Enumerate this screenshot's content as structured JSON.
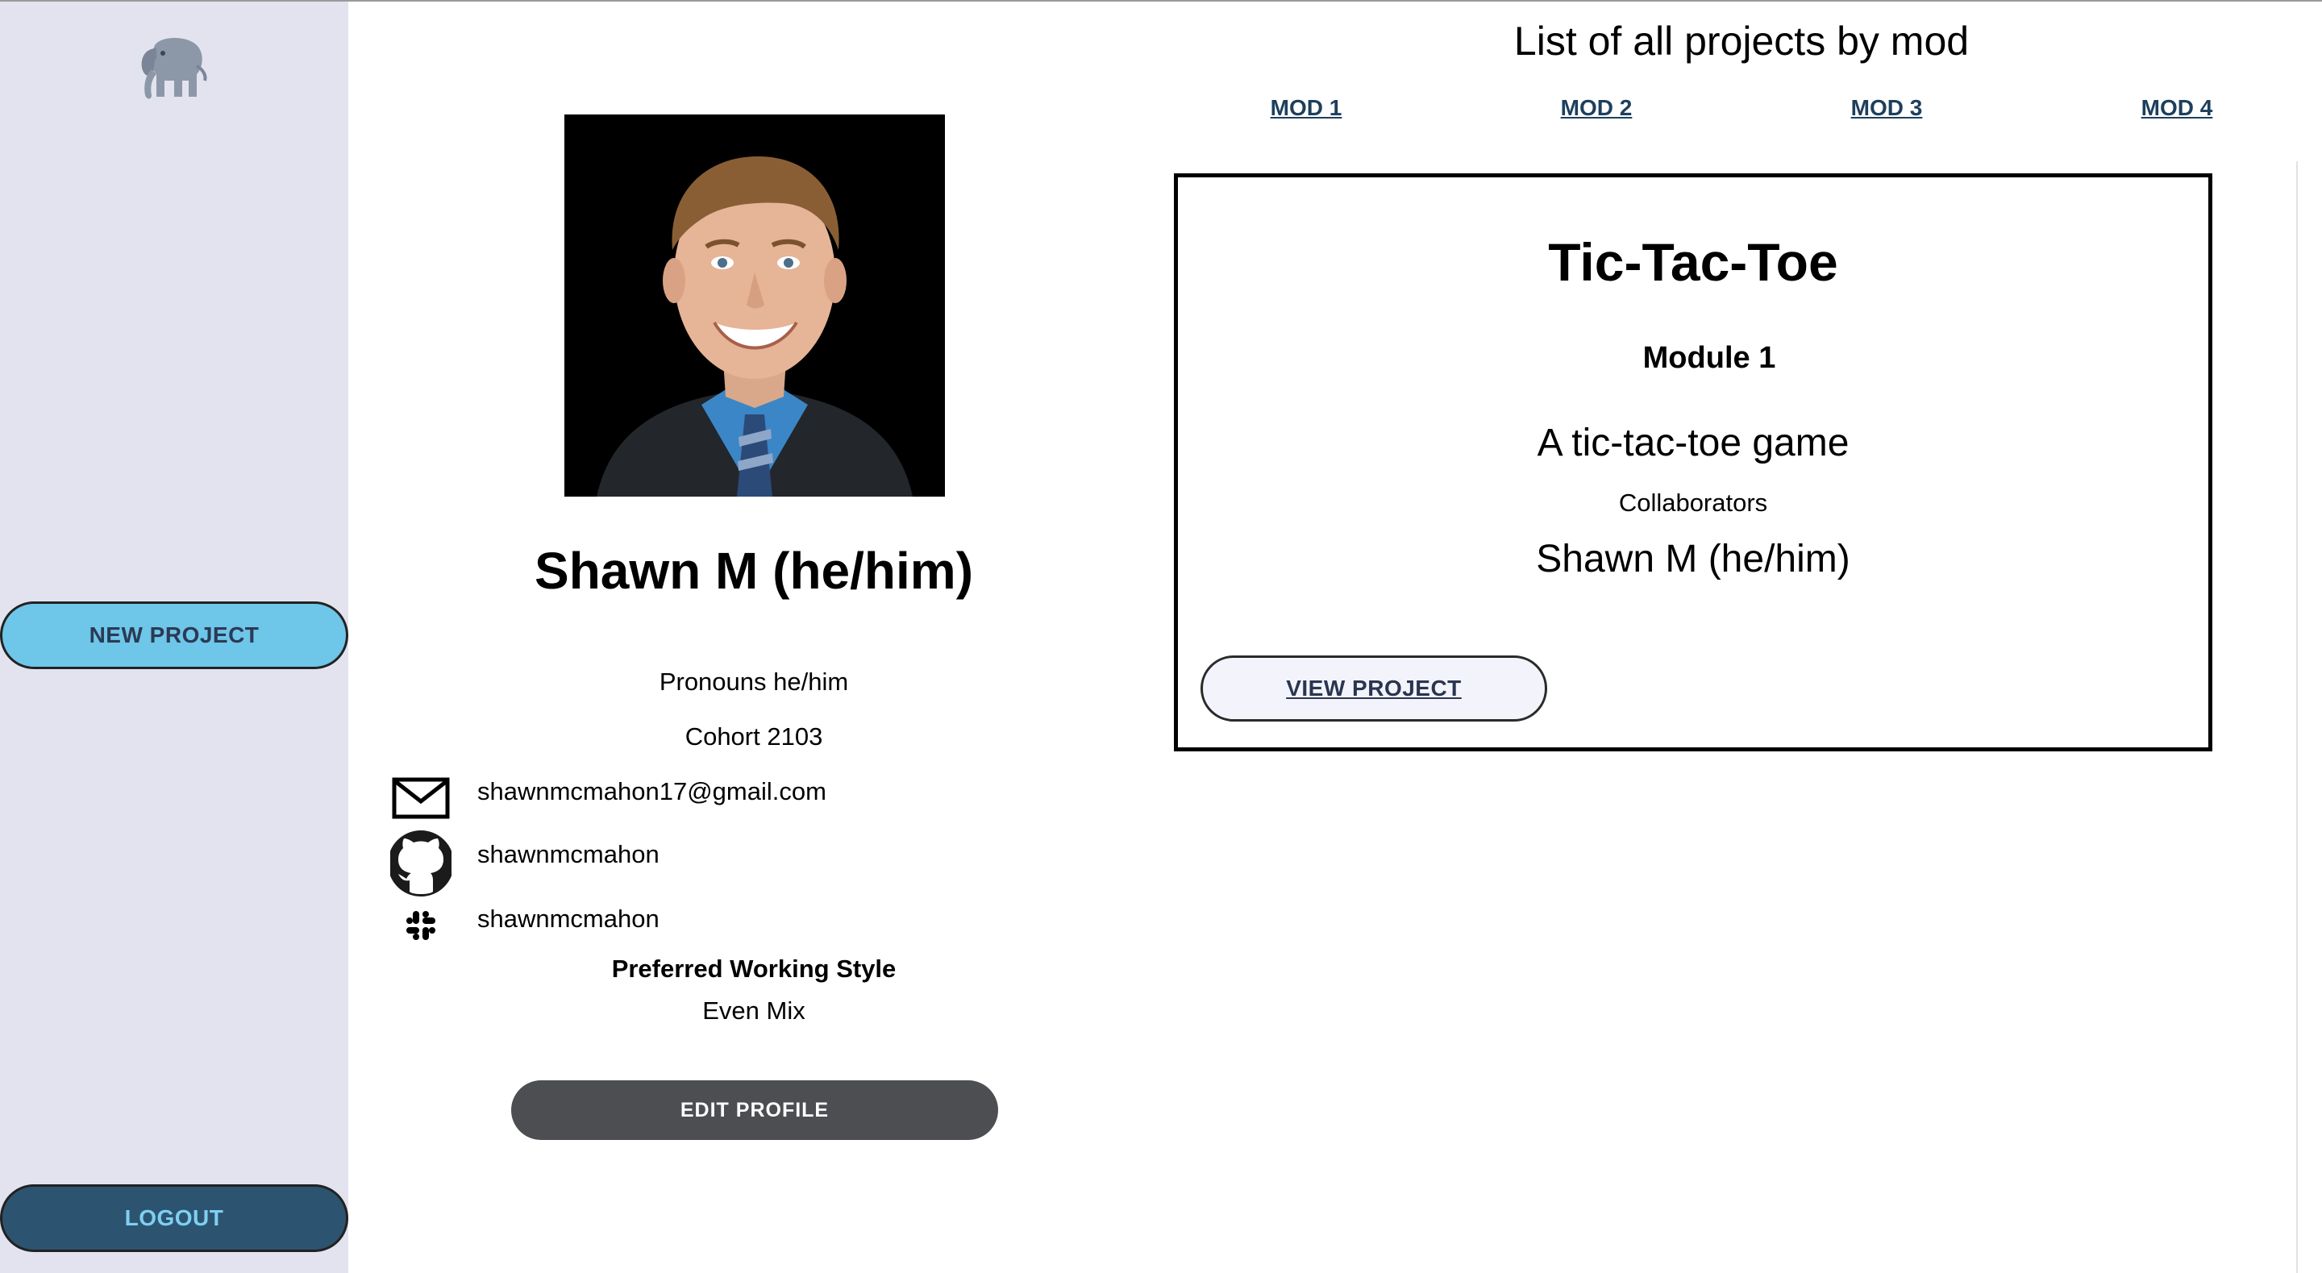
{
  "sidebar": {
    "logo_icon": "elephant-icon",
    "new_project_label": "NEW PROJECT",
    "logout_label": "LOGOUT",
    "colors": {
      "background": "#e3e3f0",
      "new_project_bg": "#6ec6e8",
      "logout_bg": "#2c5470"
    }
  },
  "profile": {
    "photo_alt": "Shawn M",
    "name": "Shawn M (he/him)",
    "pronouns": "Pronouns he/him",
    "cohort": "Cohort 2103",
    "contacts": [
      {
        "icon": "mail-icon",
        "value": "shawnmcmahon17@gmail.com"
      },
      {
        "icon": "github-icon",
        "value": "shawnmcmahon"
      },
      {
        "icon": "slack-icon",
        "value": "shawnmcmahon"
      }
    ],
    "working_style_label": "Preferred Working Style",
    "working_style_value": "Even Mix",
    "edit_label": "EDIT PROFILE"
  },
  "projects": {
    "heading": "List of all projects by mod",
    "tabs": [
      "MOD 1",
      "MOD 2",
      "MOD 3",
      "MOD 4"
    ],
    "cards": [
      {
        "title": "Tic-Tac-Toe",
        "module": "Module 1",
        "description": "A tic-tac-toe game",
        "collaborators_label": "Collaborators",
        "collaborators": "Shawn M (he/him)",
        "view_label": "VIEW PROJECT"
      }
    ]
  }
}
